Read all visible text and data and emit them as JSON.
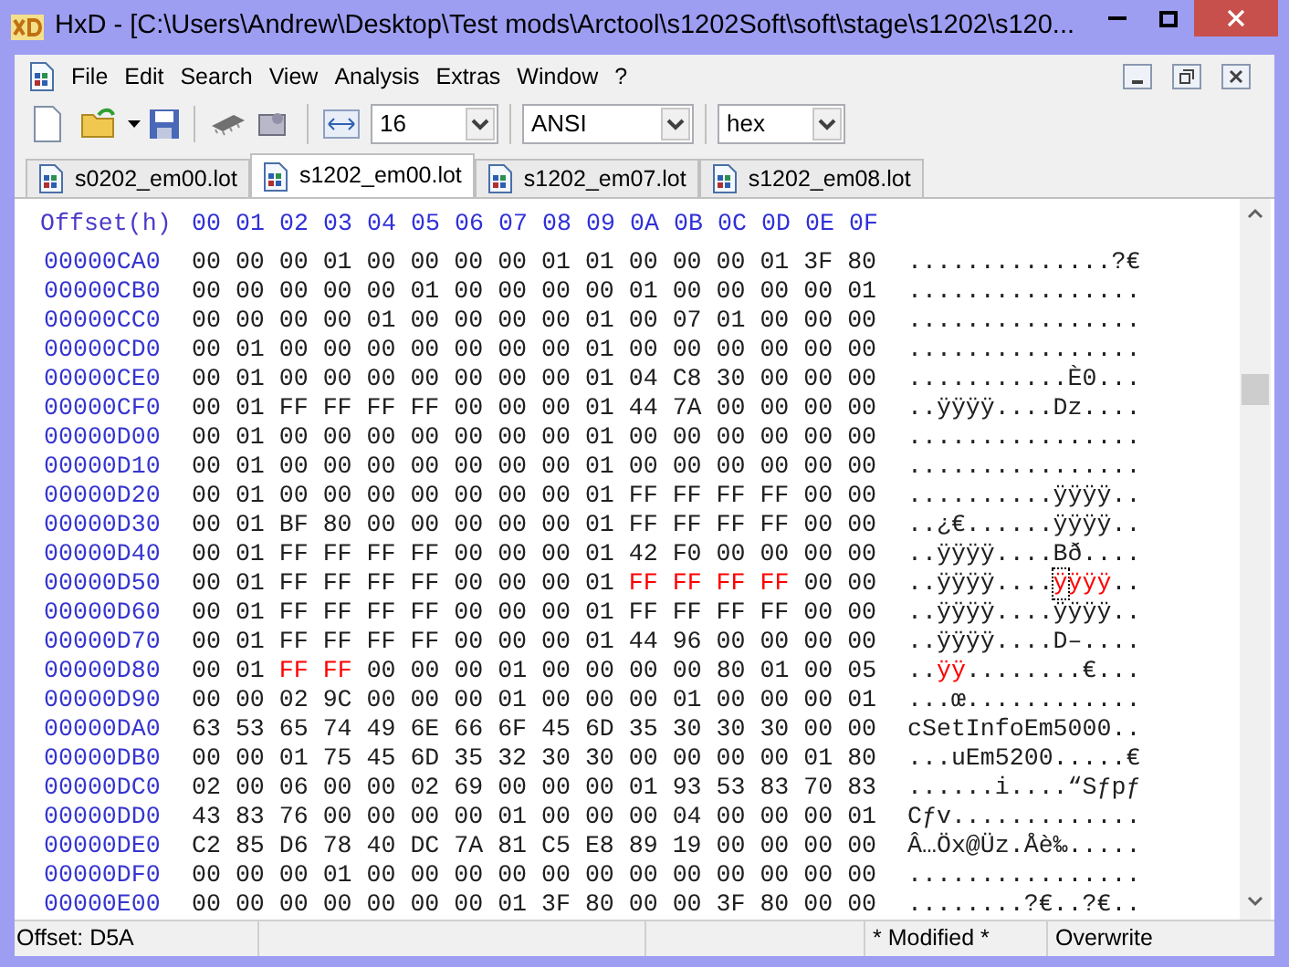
{
  "window": {
    "title": "HxD - [C:\\Users\\Andrew\\Desktop\\Test mods\\Arctool\\s1202Soft\\soft\\stage\\s1202\\s120..."
  },
  "menu": [
    "File",
    "Edit",
    "Search",
    "View",
    "Analysis",
    "Extras",
    "Window",
    "?"
  ],
  "toolbar": {
    "bytes_per_row": "16",
    "charset": "ANSI",
    "display": "hex"
  },
  "tabs": [
    {
      "label": "s0202_em00.lot",
      "selected": false
    },
    {
      "label": "s1202_em00.lot",
      "selected": true
    },
    {
      "label": "s1202_em07.lot",
      "selected": false
    },
    {
      "label": "s1202_em08.lot",
      "selected": false
    }
  ],
  "editor": {
    "offset_header": "Offset(h)",
    "columns": [
      "00",
      "01",
      "02",
      "03",
      "04",
      "05",
      "06",
      "07",
      "08",
      "09",
      "0A",
      "0B",
      "0C",
      "0D",
      "0E",
      "0F"
    ],
    "rows": [
      {
        "offset": "00000CA0",
        "hex": [
          {
            "text": "00 00 00 01 00 00 00 00 01 01 00 00 00 01 3F 80",
            "modified": false
          }
        ],
        "text": [
          {
            "text": "..............?€",
            "modified": false,
            "cursor": false
          }
        ]
      },
      {
        "offset": "00000CB0",
        "hex": [
          {
            "text": "00 00 00 00 00 01 00 00 00 00 01 00 00 00 00 01",
            "modified": false
          }
        ],
        "text": [
          {
            "text": "................",
            "modified": false,
            "cursor": false
          }
        ]
      },
      {
        "offset": "00000CC0",
        "hex": [
          {
            "text": "00 00 00 00 01 00 00 00 00 01 00 07 01 00 00 00",
            "modified": false
          }
        ],
        "text": [
          {
            "text": "................",
            "modified": false,
            "cursor": false
          }
        ]
      },
      {
        "offset": "00000CD0",
        "hex": [
          {
            "text": "00 01 00 00 00 00 00 00 00 01 00 00 00 00 00 00",
            "modified": false
          }
        ],
        "text": [
          {
            "text": "................",
            "modified": false,
            "cursor": false
          }
        ]
      },
      {
        "offset": "00000CE0",
        "hex": [
          {
            "text": "00 01 00 00 00 00 00 00 00 01 04 C8 30 00 00 00",
            "modified": false
          }
        ],
        "text": [
          {
            "text": "...........È0...",
            "modified": false,
            "cursor": false
          }
        ]
      },
      {
        "offset": "00000CF0",
        "hex": [
          {
            "text": "00 01 FF FF FF FF 00 00 00 01 44 7A 00 00 00 00",
            "modified": false
          }
        ],
        "text": [
          {
            "text": "..ÿÿÿÿ....Dz....",
            "modified": false,
            "cursor": false
          }
        ]
      },
      {
        "offset": "00000D00",
        "hex": [
          {
            "text": "00 01 00 00 00 00 00 00 00 01 00 00 00 00 00 00",
            "modified": false
          }
        ],
        "text": [
          {
            "text": "................",
            "modified": false,
            "cursor": false
          }
        ]
      },
      {
        "offset": "00000D10",
        "hex": [
          {
            "text": "00 01 00 00 00 00 00 00 00 01 00 00 00 00 00 00",
            "modified": false
          }
        ],
        "text": [
          {
            "text": "................",
            "modified": false,
            "cursor": false
          }
        ]
      },
      {
        "offset": "00000D20",
        "hex": [
          {
            "text": "00 01 00 00 00 00 00 00 00 01 FF FF FF FF 00 00",
            "modified": false
          }
        ],
        "text": [
          {
            "text": "..........ÿÿÿÿ..",
            "modified": false,
            "cursor": false
          }
        ]
      },
      {
        "offset": "00000D30",
        "hex": [
          {
            "text": "00 01 BF 80 00 00 00 00 00 01 FF FF FF FF 00 00",
            "modified": false
          }
        ],
        "text": [
          {
            "text": "..¿€......ÿÿÿÿ..",
            "modified": false,
            "cursor": false
          }
        ]
      },
      {
        "offset": "00000D40",
        "hex": [
          {
            "text": "00 01 FF FF FF FF 00 00 00 01 42 F0 00 00 00 00",
            "modified": false
          }
        ],
        "text": [
          {
            "text": "..ÿÿÿÿ....Bð....",
            "modified": false,
            "cursor": false
          }
        ]
      },
      {
        "offset": "00000D50",
        "hex": [
          {
            "text": "00 01 FF FF FF FF 00 00 00 01",
            "modified": false
          },
          {
            "text": "FF FF FF FF",
            "modified": true
          },
          {
            "text": "00 00",
            "modified": false
          }
        ],
        "text": [
          {
            "text": "..ÿÿÿÿ....",
            "modified": false,
            "cursor": false
          },
          {
            "text": "ÿ",
            "modified": true,
            "cursor": true
          },
          {
            "text": "ÿÿÿ",
            "modified": true,
            "cursor": false
          },
          {
            "text": "..",
            "modified": false,
            "cursor": false
          }
        ]
      },
      {
        "offset": "00000D60",
        "hex": [
          {
            "text": "00 01 FF FF FF FF 00 00 00 01 FF FF FF FF 00 00",
            "modified": false
          }
        ],
        "text": [
          {
            "text": "..ÿÿÿÿ....ÿÿÿÿ..",
            "modified": false,
            "cursor": false
          }
        ]
      },
      {
        "offset": "00000D70",
        "hex": [
          {
            "text": "00 01 FF FF FF FF 00 00 00 01 44 96 00 00 00 00",
            "modified": false
          }
        ],
        "text": [
          {
            "text": "..ÿÿÿÿ....D–....",
            "modified": false,
            "cursor": false
          }
        ]
      },
      {
        "offset": "00000D80",
        "hex": [
          {
            "text": "00 01",
            "modified": false
          },
          {
            "text": "FF FF",
            "modified": true
          },
          {
            "text": "00 00 00 01 00 00 00 00 80 01 00 05",
            "modified": false
          }
        ],
        "text": [
          {
            "text": "..",
            "modified": false,
            "cursor": false
          },
          {
            "text": "ÿÿ",
            "modified": true,
            "cursor": false
          },
          {
            "text": "........€...",
            "modified": false,
            "cursor": false
          }
        ]
      },
      {
        "offset": "00000D90",
        "hex": [
          {
            "text": "00 00 02 9C 00 00 00 01 00 00 00 01 00 00 00 01",
            "modified": false
          }
        ],
        "text": [
          {
            "text": "...œ............",
            "modified": false,
            "cursor": false
          }
        ]
      },
      {
        "offset": "00000DA0",
        "hex": [
          {
            "text": "63 53 65 74 49 6E 66 6F 45 6D 35 30 30 30 00 00",
            "modified": false
          }
        ],
        "text": [
          {
            "text": "cSetInfoEm5000..",
            "modified": false,
            "cursor": false
          }
        ]
      },
      {
        "offset": "00000DB0",
        "hex": [
          {
            "text": "00 00 01 75 45 6D 35 32 30 30 00 00 00 00 01 80",
            "modified": false
          }
        ],
        "text": [
          {
            "text": "...uEm5200.....€",
            "modified": false,
            "cursor": false
          }
        ]
      },
      {
        "offset": "00000DC0",
        "hex": [
          {
            "text": "02 00 06 00 00 02 69 00 00 00 01 93 53 83 70 83",
            "modified": false
          }
        ],
        "text": [
          {
            "text": "......i....“Sƒpƒ",
            "modified": false,
            "cursor": false
          }
        ]
      },
      {
        "offset": "00000DD0",
        "hex": [
          {
            "text": "43 83 76 00 00 00 00 01 00 00 00 04 00 00 00 01",
            "modified": false
          }
        ],
        "text": [
          {
            "text": "Cƒv.............",
            "modified": false,
            "cursor": false
          }
        ]
      },
      {
        "offset": "00000DE0",
        "hex": [
          {
            "text": "C2 85 D6 78 40 DC 7A 81 C5 E8 89 19 00 00 00 00",
            "modified": false
          }
        ],
        "text": [
          {
            "text": "Â",
            "modified": false,
            "cursor": false
          },
          {
            "text": "…Öx@Üz.Åè‰.....",
            "modified": false,
            "cursor": false
          }
        ]
      },
      {
        "offset": "00000DF0",
        "hex": [
          {
            "text": "00 00 00 01 00 00 00 00 00 00 00 00 00 00 00 00",
            "modified": false
          }
        ],
        "text": [
          {
            "text": "................",
            "modified": false,
            "cursor": false
          }
        ]
      },
      {
        "offset": "00000E00",
        "hex": [
          {
            "text": "00 00 00 00 00 00 00 01 3F 80 00 00 3F 80 00 00",
            "modified": false
          }
        ],
        "text": [
          {
            "text": "........?€..?€..",
            "modified": false,
            "cursor": false
          }
        ]
      }
    ]
  },
  "status_bar": {
    "offset": "Offset: D5A",
    "modified": "* Modified *",
    "mode": "Overwrite"
  }
}
